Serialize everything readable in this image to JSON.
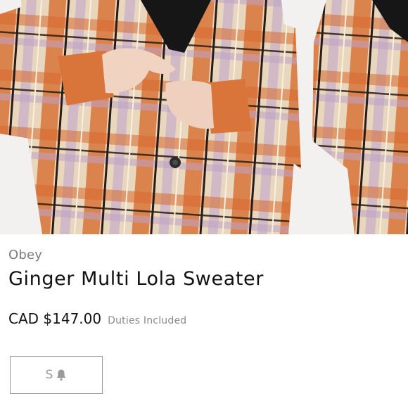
{
  "product": {
    "brand": "Obey",
    "name": "Ginger Multi Lola Sweater",
    "price": "CAD $147.00",
    "price_note": "Duties Included"
  },
  "sizes": [
    {
      "label": "S",
      "status_icon": "bell-icon",
      "sold_out": true
    }
  ],
  "gallery": {
    "images": [
      {
        "subject": "model-wearing-plaid-mohair-cardigan"
      },
      {
        "subject": "plaid-cardigan-side-view"
      }
    ]
  },
  "colors": {
    "text_primary": "#111111",
    "text_muted": "#7d7d7d",
    "border": "#9a9a9a",
    "sweater_orange": "#d9743a",
    "sweater_cream": "#efe3cf",
    "sweater_lilac": "#c8aecb"
  }
}
